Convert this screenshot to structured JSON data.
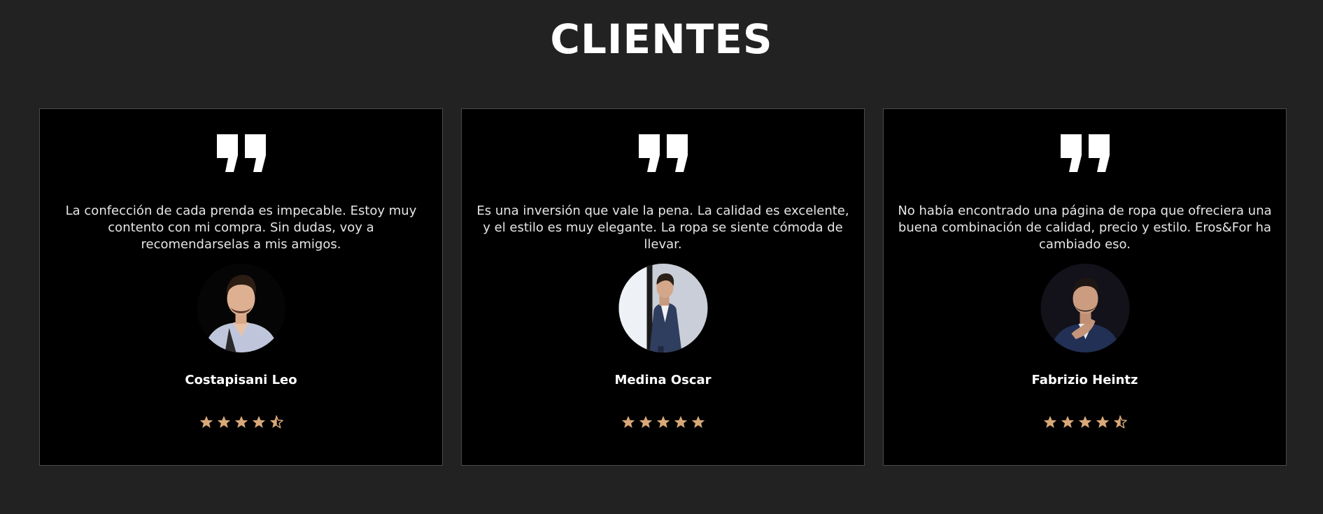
{
  "section": {
    "title": "CLIENTES"
  },
  "colors": {
    "background": "#222222",
    "card_background": "#000000",
    "card_border": "#4a4a4a",
    "star": "#d9a878",
    "text": "#e6e6e6"
  },
  "testimonials": [
    {
      "icon": "quote-icon",
      "text": "La confección de cada prenda es impecable. Estoy muy contento con mi compra. Sin dudas, voy a recomendarselas a mis amigos.",
      "name": "Costapisani Leo",
      "rating": 4.5,
      "avatar": "client-photo"
    },
    {
      "icon": "quote-icon",
      "text": "Es una inversión que vale la pena. La calidad es excelente, y el estilo es muy elegante. La ropa se siente cómoda de llevar.",
      "name": "Medina Oscar",
      "rating": 5,
      "avatar": "client-photo"
    },
    {
      "icon": "quote-icon",
      "text": "No había encontrado una página de ropa que ofreciera una buena combinación de calidad, precio y estilo. Eros&For ha cambiado eso.",
      "name": "Fabrizio Heintz",
      "rating": 4.5,
      "avatar": "client-photo"
    }
  ]
}
